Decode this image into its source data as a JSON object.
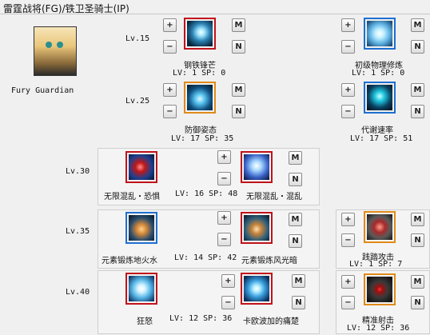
{
  "header": {
    "title": "雷霆战将(FG)/铁卫圣骑士(IP)"
  },
  "character": {
    "name": "Fury Guardian"
  },
  "buttons": {
    "plus": "+",
    "minus": "−",
    "max": "M",
    "none": "N"
  },
  "rows": [
    {
      "level": "Lv.15",
      "skills": [
        {
          "name": "钢铁锋芒",
          "stats": "LV: 1   SP: 0",
          "icon": "steel-spike-icon",
          "border": "#c0121a"
        },
        {
          "name": "初级物理修炼",
          "stats": "LV: 1   SP: 0",
          "icon": "muscle-arm-icon",
          "border": "#1e6fd0"
        }
      ]
    },
    {
      "level": "Lv.25",
      "skills": [
        {
          "name": "防御姿态",
          "stats": "LV: 17   SP: 35",
          "icon": "defense-stance-icon",
          "border": "#e08a1a"
        },
        {
          "name": "代谢速率",
          "stats": "LV: 17   SP: 51",
          "icon": "metabolism-icon",
          "border": "#1e6fd0"
        }
      ]
    },
    {
      "level": "Lv.30",
      "skills": [
        {
          "name": "无限混乱・恐惧",
          "stats": "LV: 16   SP: 48",
          "icon": "chaos-fear-icon",
          "border": "#c0121a"
        },
        {
          "name": "无限混乱・混乱",
          "stats": "",
          "icon": "chaos-confuse-icon",
          "border": "#c0121a"
        }
      ]
    },
    {
      "level": "Lv.35",
      "skills": [
        {
          "name": "元素锻炼地火水",
          "stats": "LV: 14   SP: 42",
          "icon": "element-earth-fire-water-icon",
          "border": "#1e6fd0"
        },
        {
          "name": "元素锻炼风光暗",
          "stats": "",
          "icon": "element-wind-light-dark-icon",
          "border": "#c0121a"
        },
        {
          "name": "践踏攻击",
          "stats": "LV: 1   SP: 7",
          "icon": "stomp-attack-icon",
          "border": "#e08a1a"
        }
      ]
    },
    {
      "level": "Lv.40",
      "skills": [
        {
          "name": "狂怒",
          "stats": "LV: 12   SP: 36",
          "icon": "fury-icon",
          "border": "#c0121a"
        },
        {
          "name": "卡欧波加的痛楚",
          "stats": "",
          "icon": "kaopoga-pain-icon",
          "border": "#c0121a"
        },
        {
          "name": "精准射击",
          "stats": "LV: 12   SP: 36",
          "icon": "precise-shot-icon",
          "border": "#e08a1a"
        }
      ]
    }
  ]
}
